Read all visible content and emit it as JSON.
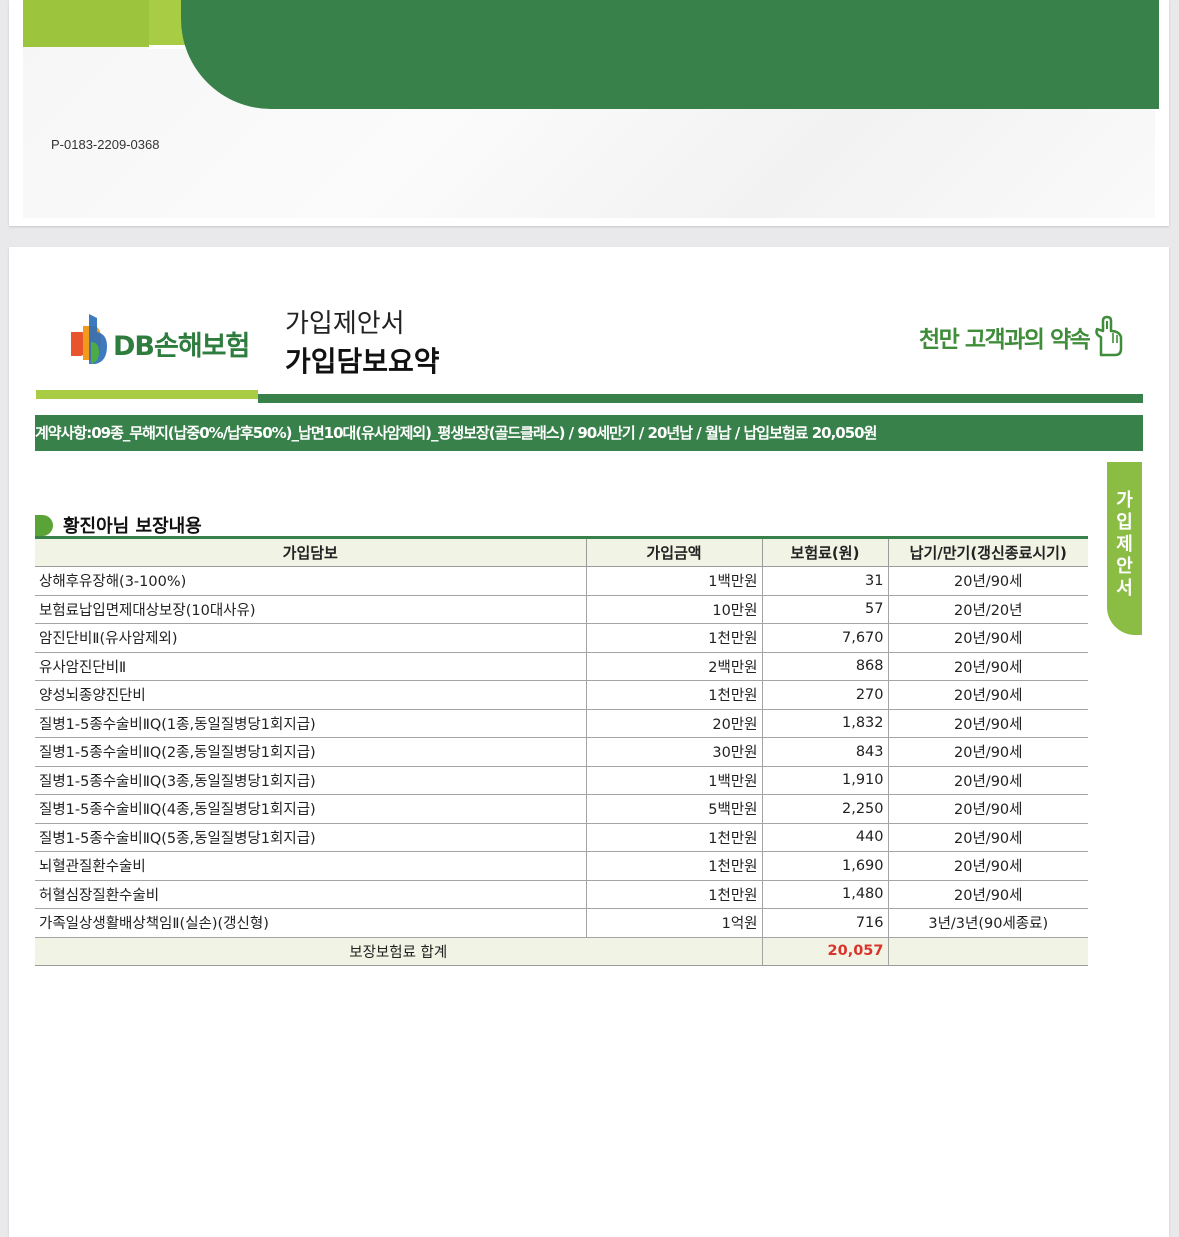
{
  "doc_number": "P-0183-2209-0368",
  "logo": {
    "brand": "DB손해보험"
  },
  "header": {
    "subtitle": "가입제안서",
    "title": "가입담보요약",
    "slogan": "천만 고객과의 약속"
  },
  "contract_summary": "계약사항:09종_무해지(납중0%/납후50%)_납면10대(유사암제외)_평생보장(골드클래스) / 90세만기 / 20년납 / 월납 / 납입보험료 20,050원",
  "side_tab": [
    "가",
    "입",
    "제",
    "안",
    "서"
  ],
  "section_title": "황진아님 보장내용",
  "table": {
    "headers": [
      "가입담보",
      "가입금액",
      "보험료(원)",
      "납기/만기(갱신종료시기)"
    ],
    "rows": [
      [
        "상해후유장해(3-100%)",
        "1백만원",
        "31",
        "20년/90세"
      ],
      [
        "보험료납입면제대상보장(10대사유)",
        "10만원",
        "57",
        "20년/20년"
      ],
      [
        "암진단비Ⅱ(유사암제외)",
        "1천만원",
        "7,670",
        "20년/90세"
      ],
      [
        "유사암진단비Ⅱ",
        "2백만원",
        "868",
        "20년/90세"
      ],
      [
        "양성뇌종양진단비",
        "1천만원",
        "270",
        "20년/90세"
      ],
      [
        "질병1-5종수술비ⅡQ(1종,동일질병당1회지급)",
        "20만원",
        "1,832",
        "20년/90세"
      ],
      [
        "질병1-5종수술비ⅡQ(2종,동일질병당1회지급)",
        "30만원",
        "843",
        "20년/90세"
      ],
      [
        "질병1-5종수술비ⅡQ(3종,동일질병당1회지급)",
        "1백만원",
        "1,910",
        "20년/90세"
      ],
      [
        "질병1-5종수술비ⅡQ(4종,동일질병당1회지급)",
        "5백만원",
        "2,250",
        "20년/90세"
      ],
      [
        "질병1-5종수술비ⅡQ(5종,동일질병당1회지급)",
        "1천만원",
        "440",
        "20년/90세"
      ],
      [
        "뇌혈관질환수술비",
        "1천만원",
        "1,690",
        "20년/90세"
      ],
      [
        "허혈심장질환수술비",
        "1천만원",
        "1,480",
        "20년/90세"
      ],
      [
        "가족일상생활배상책임Ⅱ(실손)(갱신형)",
        "1억원",
        "716",
        "3년/3년(90세종료)"
      ]
    ],
    "total_label": "보장보험료 합계",
    "total_value": "20,057"
  },
  "colors": {
    "primary_green": "#38814a",
    "lime": "#a9cc45",
    "side_tab": "#8bbd44",
    "total_red": "#d9342b"
  }
}
